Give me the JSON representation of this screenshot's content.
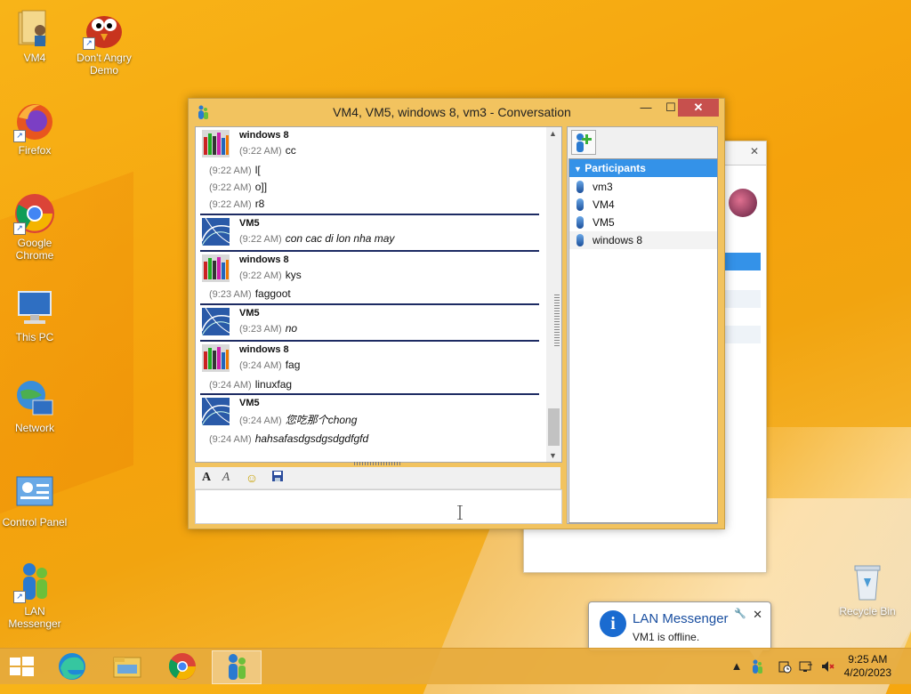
{
  "desktop": {
    "icons": [
      {
        "label": "VM4",
        "icon": "user-folder-icon"
      },
      {
        "label": "Don't Angry Demo",
        "icon": "red-bird-game-icon"
      },
      {
        "label": "Firefox",
        "icon": "firefox-icon"
      },
      {
        "label": "Google Chrome",
        "icon": "chrome-icon"
      },
      {
        "label": "This PC",
        "icon": "computer-icon"
      },
      {
        "label": "Network",
        "icon": "network-icon"
      },
      {
        "label": "Control Panel",
        "icon": "control-panel-icon"
      },
      {
        "label": "LAN Messenger",
        "icon": "lan-messenger-icon"
      },
      {
        "label": "Recycle Bin",
        "icon": "recycle-bin-icon"
      }
    ]
  },
  "conversation": {
    "title": "VM4, VM5, windows 8, vm3 - Conversation",
    "controls": {
      "minimize": "—",
      "maximize": "☐",
      "close": "✕"
    },
    "messages": [
      {
        "sender": "windows 8",
        "lines": [
          {
            "time": "(9:22 AM)",
            "text": "cc"
          },
          {
            "time": "(9:22 AM)",
            "text": "l["
          },
          {
            "time": "(9:22 AM)",
            "text": "o]]"
          },
          {
            "time": "(9:22 AM)",
            "text": "r8"
          }
        ]
      },
      {
        "sender": "VM5",
        "lines": [
          {
            "time": "(9:22 AM)",
            "text": "con cac di lon nha may"
          }
        ]
      },
      {
        "sender": "windows 8",
        "lines": [
          {
            "time": "(9:22 AM)",
            "text": "kys"
          },
          {
            "time": "(9:23 AM)",
            "text": "faggoot"
          }
        ]
      },
      {
        "sender": "VM5",
        "lines": [
          {
            "time": "(9:23 AM)",
            "text": "no"
          }
        ]
      },
      {
        "sender": "windows 8",
        "lines": [
          {
            "time": "(9:24 AM)",
            "text": "fag"
          },
          {
            "time": "(9:24 AM)",
            "text": "linuxfag"
          }
        ]
      },
      {
        "sender": "VM5",
        "lines": [
          {
            "time": "(9:24 AM)",
            "text": "您吃那个chong"
          },
          {
            "time": "(9:24 AM)",
            "text": "hahsafasdgsdgsdgdfgfd"
          }
        ]
      }
    ],
    "toolbar": {
      "font": "A",
      "color": "A",
      "emoji": "☺",
      "save": "💾"
    },
    "input_value": "",
    "participants_header": "Participants",
    "participants": [
      "vm3",
      "VM4",
      "VM5",
      "windows 8"
    ]
  },
  "notification": {
    "title": "LAN Messenger",
    "message": "VM1 is offline.",
    "close": "✕",
    "pin": "🔧"
  },
  "taskbar": {
    "time": "9:25 AM",
    "date": "4/20/2023",
    "tray_chevron": "▲"
  }
}
